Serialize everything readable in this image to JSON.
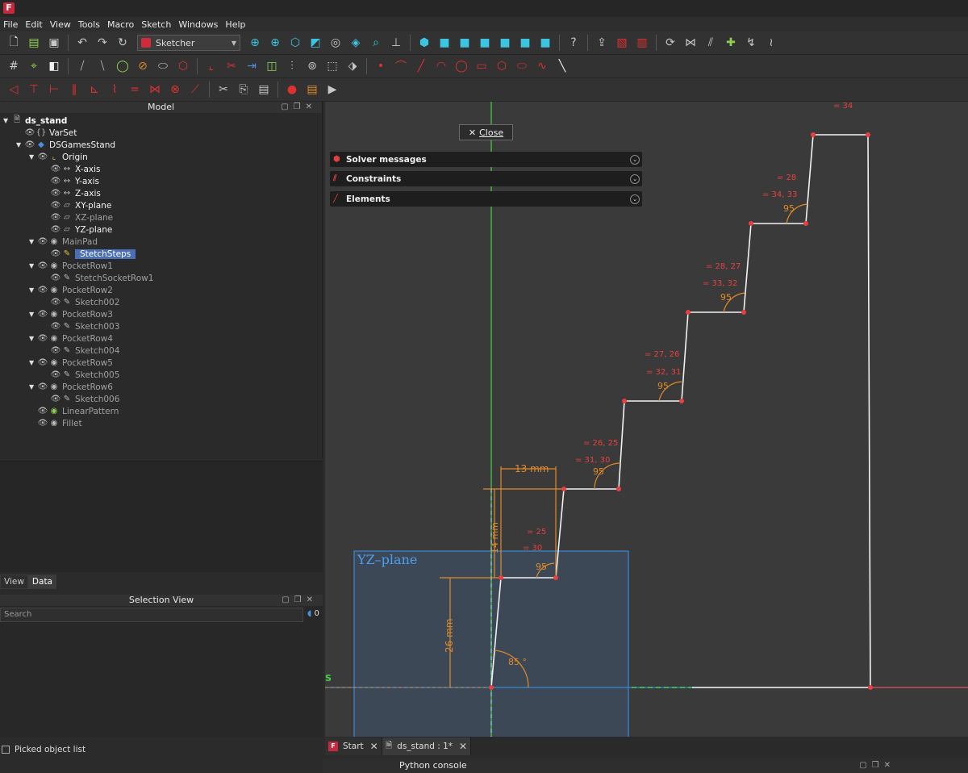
{
  "menu": [
    "File",
    "Edit",
    "View",
    "Tools",
    "Macro",
    "Sketch",
    "Windows",
    "Help"
  ],
  "workbench": "Sketcher",
  "model_panel": {
    "title": "Model",
    "tree": [
      {
        "label": "ds_stand",
        "depth": 0,
        "style": "bold"
      },
      {
        "label": "VarSet",
        "depth": 1,
        "style": "white"
      },
      {
        "label": "DSGamesStand",
        "depth": 1,
        "style": "white"
      },
      {
        "label": "Origin",
        "depth": 2,
        "style": "white"
      },
      {
        "label": "X-axis",
        "depth": 3,
        "style": "white"
      },
      {
        "label": "Y-axis",
        "depth": 3,
        "style": "white"
      },
      {
        "label": "Z-axis",
        "depth": 3,
        "style": "white"
      },
      {
        "label": "XY-plane",
        "depth": 3,
        "style": "white"
      },
      {
        "label": "XZ-plane",
        "depth": 3,
        "style": "grey"
      },
      {
        "label": "YZ-plane",
        "depth": 3,
        "style": "white"
      },
      {
        "label": "MainPad",
        "depth": 2,
        "style": "grey"
      },
      {
        "label": "StetchSteps",
        "depth": 3,
        "style": "selected"
      },
      {
        "label": "PocketRow1",
        "depth": 2,
        "style": "grey"
      },
      {
        "label": "StetchSocketRow1",
        "depth": 3,
        "style": "grey"
      },
      {
        "label": "PocketRow2",
        "depth": 2,
        "style": "grey"
      },
      {
        "label": "Sketch002",
        "depth": 3,
        "style": "grey"
      },
      {
        "label": "PocketRow3",
        "depth": 2,
        "style": "grey"
      },
      {
        "label": "Sketch003",
        "depth": 3,
        "style": "grey"
      },
      {
        "label": "PocketRow4",
        "depth": 2,
        "style": "grey"
      },
      {
        "label": "Sketch004",
        "depth": 3,
        "style": "grey"
      },
      {
        "label": "PocketRow5",
        "depth": 2,
        "style": "grey"
      },
      {
        "label": "Sketch005",
        "depth": 3,
        "style": "grey"
      },
      {
        "label": "PocketRow6",
        "depth": 2,
        "style": "grey"
      },
      {
        "label": "Sketch006",
        "depth": 3,
        "style": "grey"
      },
      {
        "label": "LinearPattern",
        "depth": 2,
        "style": "grey"
      },
      {
        "label": "Fillet",
        "depth": 2,
        "style": "grey"
      }
    ]
  },
  "tabs": {
    "view": "View",
    "data": "Data"
  },
  "selection_view": {
    "title": "Selection View",
    "search_placeholder": "Search",
    "count": "0"
  },
  "picked_list": "Picked object list",
  "task": {
    "close": "Close",
    "panels": [
      "Solver messages",
      "Constraints",
      "Elements"
    ]
  },
  "sketch": {
    "plane_label": "YZ–plane",
    "axis_label": "S",
    "dim_13": "13 mm",
    "dim_26": "26 mm",
    "dim_vert": "14 mm",
    "angle_85": "85 °",
    "angle_95": "95",
    "eq_labels": [
      "= 34",
      "= 28",
      "= 34, 33",
      "= 28, 27",
      "= 33, 32",
      "= 27, 26",
      "= 32, 31",
      "= 26, 25",
      "= 31, 30",
      "= 25",
      "= 30"
    ]
  },
  "doc_tabs": [
    "Start",
    "ds_stand : 1*"
  ],
  "python_console": "Python console"
}
